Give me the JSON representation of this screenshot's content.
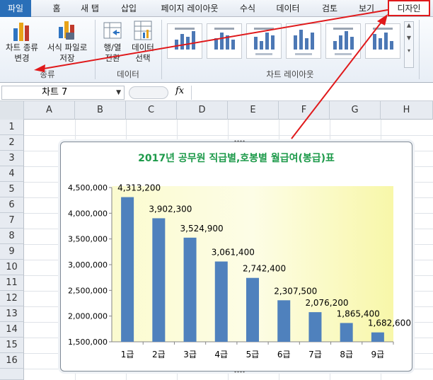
{
  "ribbon_tabs": [
    "파일",
    "홈",
    "새 탭",
    "삽입",
    "페이지 레이아웃",
    "수식",
    "데이터",
    "검토",
    "보기",
    "디자인"
  ],
  "ribbon": {
    "change_chart_type": "차트 종류\n변경",
    "save_as_template": "서식 파일로\n저장",
    "switch_row_col": "행/열\n전환",
    "select_data": "데이터\n선택",
    "group_type": "종류",
    "group_data": "데이터",
    "group_layouts": "차트 레이아웃"
  },
  "formula_bar": {
    "name_box": "차트 7",
    "fx_label": "fx",
    "value": ""
  },
  "columns": [
    "A",
    "B",
    "C",
    "D",
    "E",
    "F",
    "G",
    "H"
  ],
  "rows": [
    "1",
    "2",
    "3",
    "4",
    "5",
    "6",
    "7",
    "8",
    "9",
    "10",
    "11",
    "12",
    "13",
    "14",
    "15",
    "16"
  ],
  "colors": {
    "accent_red": "#e0191b",
    "bar": "#4f81bd",
    "title": "#1d9a4a"
  },
  "chart_data": {
    "type": "bar",
    "title": "2017년 공무원 직급별,호봉별 월급여(봉급)표",
    "categories": [
      "1급",
      "2급",
      "3급",
      "4급",
      "5급",
      "6급",
      "7급",
      "8급",
      "9급"
    ],
    "values": [
      4313200,
      3902300,
      3524900,
      3061400,
      2742400,
      2307500,
      2076200,
      1865400,
      1682600
    ],
    "data_labels": [
      "4,313,200",
      "3,902,300",
      "3,524,900",
      "3,061,400",
      "2,742,400",
      "2,307,500",
      "2,076,200",
      "1,865,400",
      "1,682,600"
    ],
    "ylim": [
      1500000,
      4500000
    ],
    "yticks": [
      "1,500,000",
      "2,000,000",
      "2,500,000",
      "3,000,000",
      "3,500,000",
      "4,000,000",
      "4,500,000"
    ],
    "grid": false,
    "legend": "none"
  }
}
